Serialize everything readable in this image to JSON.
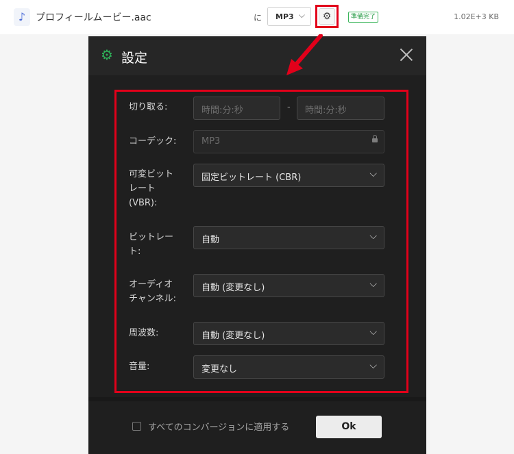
{
  "file": {
    "icon": "music-note-icon",
    "name": "プロフィールムービー.aac",
    "to_label": "に",
    "format": "MP3",
    "status_badge": "準備完了",
    "size": "1.02E+3 KB"
  },
  "dialog": {
    "title": "設定",
    "rows": {
      "trim": {
        "label": "切り取る:",
        "start_placeholder": "時間:分:秒",
        "separator": "-",
        "end_placeholder": "時間:分:秒"
      },
      "codec": {
        "label": "コーデック:",
        "value": "MP3"
      },
      "vbr": {
        "label_lines": [
          "可変ビット",
          "レート",
          "(VBR):"
        ],
        "value": "固定ビットレート (CBR)"
      },
      "bitrate": {
        "label_lines": [
          "ビットレー",
          "ト:"
        ],
        "value": "自動"
      },
      "channel": {
        "label_lines": [
          "オーディオ",
          "チャンネル:"
        ],
        "value": "自動 (変更なし)"
      },
      "frequency": {
        "label": "周波数:",
        "value": "自動 (変更なし)"
      },
      "volume": {
        "label": "音量:",
        "value": "変更なし"
      }
    },
    "apply_all_label": "すべてのコンバージョンに適用する",
    "ok_label": "Ok"
  },
  "colors": {
    "accent_red": "#e2001a",
    "gear_green": "#2fb159",
    "dialog_bg": "#1f1f1f"
  }
}
